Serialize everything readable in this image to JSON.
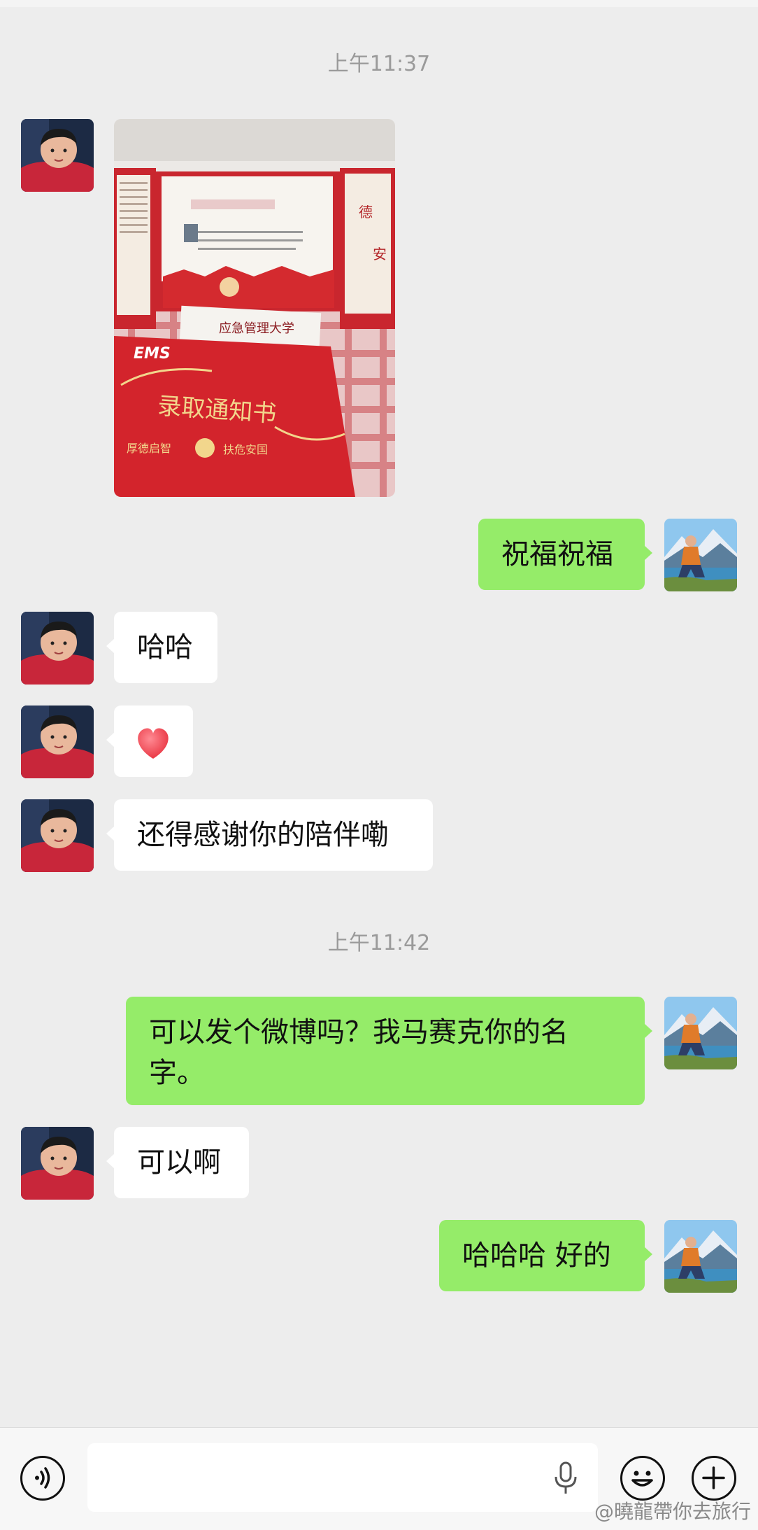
{
  "chat": {
    "timestamp_1": "上午11:37",
    "timestamp_2": "上午11:42",
    "messages": [
      {
        "from": "friend",
        "type": "image",
        "content": "admission-letter-photo"
      },
      {
        "from": "me",
        "type": "text",
        "text": "祝福祝福"
      },
      {
        "from": "friend",
        "type": "text",
        "text": "哈哈"
      },
      {
        "from": "friend",
        "type": "emoji",
        "content": "heart-emoji"
      },
      {
        "from": "friend",
        "type": "text",
        "text": "还得感谢你的陪伴嘞"
      },
      {
        "from": "me",
        "type": "text",
        "text": "可以发个微博吗？我马赛克你的名字。"
      },
      {
        "from": "friend",
        "type": "text",
        "text": "可以啊"
      },
      {
        "from": "me",
        "type": "text",
        "text": "哈哈哈 好的"
      }
    ]
  },
  "photo_text": {
    "envelope_brand": "EMS",
    "university": "应急管理大学",
    "letter_title": "录取通知书",
    "motto_left": "厚德启智",
    "motto_right": "扶危安国"
  },
  "icons": {
    "voice": "voice-toggle-icon",
    "mic": "microphone-icon",
    "emoji": "emoji-icon",
    "plus": "plus-icon"
  },
  "colors": {
    "background": "#ededed",
    "incoming_bubble": "#ffffff",
    "outgoing_bubble": "#95ec69",
    "timestamp": "#9a9a9a"
  },
  "watermark": "@曉龍帶你去旅行"
}
